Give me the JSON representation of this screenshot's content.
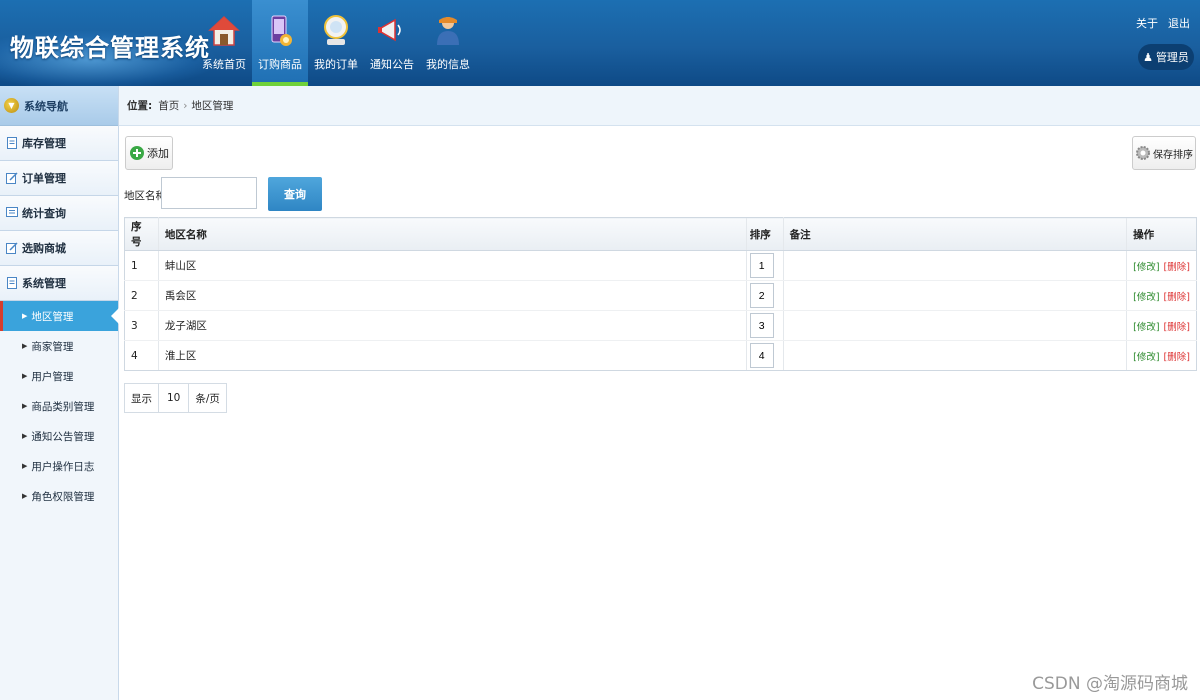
{
  "header": {
    "brand": "物联综合管理系统",
    "nav": [
      {
        "label": "系统首页",
        "icon": "house-icon",
        "active": false
      },
      {
        "label": "订购商品",
        "icon": "phone-icon",
        "active": true
      },
      {
        "label": "我的订单",
        "icon": "monitor-icon",
        "active": false
      },
      {
        "label": "通知公告",
        "icon": "megaphone-icon",
        "active": false
      },
      {
        "label": "我的信息",
        "icon": "user-icon",
        "active": false
      }
    ],
    "links": {
      "about": "关于",
      "logout": "退出"
    },
    "user": "管理员"
  },
  "sidebar": {
    "title": "系统导航",
    "groups": [
      {
        "label": "库存管理"
      },
      {
        "label": "订单管理"
      },
      {
        "label": "统计查询"
      },
      {
        "label": "选购商城"
      },
      {
        "label": "系统管理"
      }
    ],
    "items": [
      {
        "label": "地区管理",
        "active": true
      },
      {
        "label": "商家管理"
      },
      {
        "label": "用户管理"
      },
      {
        "label": "商品类别管理"
      },
      {
        "label": "通知公告管理"
      },
      {
        "label": "用户操作日志"
      },
      {
        "label": "角色权限管理"
      }
    ]
  },
  "breadcrumb": {
    "prefix": "位置:",
    "home": "首页",
    "sep": "›",
    "current": "地区管理"
  },
  "toolbar": {
    "add_label": "添加",
    "save_sort_label": "保存排序"
  },
  "search": {
    "label": "地区名称",
    "value": "",
    "placeholder": "",
    "button": "查询"
  },
  "table": {
    "headers": {
      "idx": "序号",
      "name": "地区名称",
      "sort": "排序",
      "note": "备注",
      "ops": "操作"
    },
    "rows": [
      {
        "idx": "1",
        "name": "蚌山区",
        "sort": "1",
        "note": ""
      },
      {
        "idx": "2",
        "name": "禹会区",
        "sort": "2",
        "note": ""
      },
      {
        "idx": "3",
        "name": "龙子湖区",
        "sort": "3",
        "note": ""
      },
      {
        "idx": "4",
        "name": "淮上区",
        "sort": "4",
        "note": ""
      }
    ],
    "edit_label": "[修改]",
    "delete_label": "[删除]"
  },
  "pager": {
    "show": "显示",
    "size": "10",
    "unit": "条/页"
  },
  "watermark": "CSDN @淘源码商城"
}
